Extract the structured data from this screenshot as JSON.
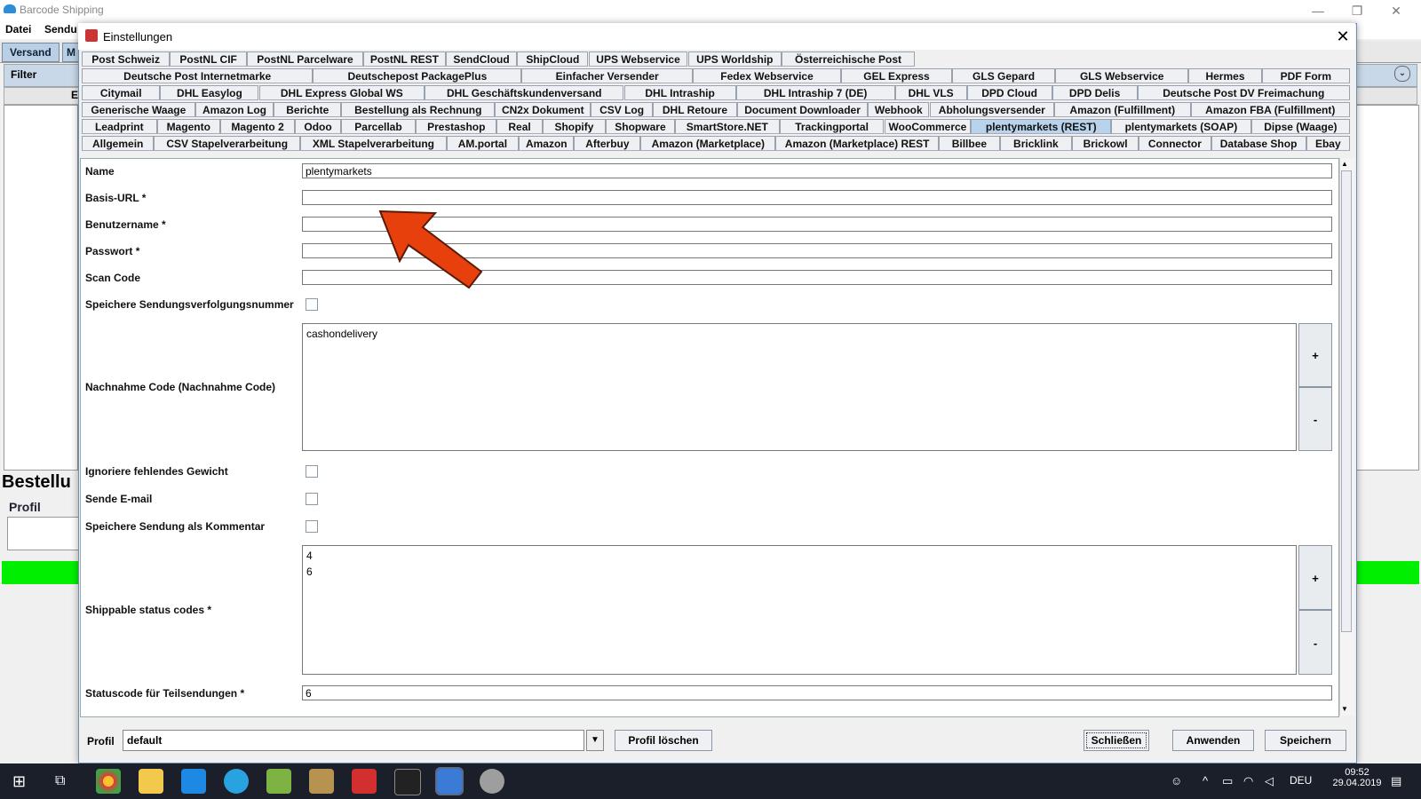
{
  "app": {
    "title": "Barcode Shipping",
    "menu": [
      "Datei",
      "Sendu"
    ],
    "tabs": [
      "Versand",
      "M"
    ],
    "filter_label": "Filter",
    "list_header": "E",
    "section_title": "Bestellu",
    "profil_label": "Profil"
  },
  "dialog": {
    "title": "Einstellungen",
    "close_glyph": "✕",
    "tab_rows": [
      [
        "Post Schweiz",
        "PostNL CIF",
        "PostNL Parcelware",
        "PostNL REST",
        "SendCloud",
        "ShipCloud",
        "UPS Webservice",
        "UPS Worldship",
        "Österreichische Post"
      ],
      [
        "Deutsche Post Internetmarke",
        "Deutschepost PackagePlus",
        "Einfacher Versender",
        "Fedex Webservice",
        "GEL Express",
        "GLS Gepard",
        "GLS Webservice",
        "Hermes",
        "PDF Form"
      ],
      [
        "Citymail",
        "DHL Easylog",
        "DHL Express Global WS",
        "DHL Geschäftskundenversand",
        "DHL Intraship",
        "DHL Intraship 7 (DE)",
        "DHL VLS",
        "DPD Cloud",
        "DPD Delis",
        "Deutsche Post DV Freimachung"
      ],
      [
        "Generische Waage",
        "Amazon Log",
        "Berichte",
        "Bestellung als Rechnung",
        "CN2x Dokument",
        "CSV Log",
        "DHL Retoure",
        "Document Downloader",
        "Webhook",
        "Abholungsversender",
        "Amazon (Fulfillment)",
        "Amazon FBA (Fulfillment)"
      ],
      [
        "Leadprint",
        "Magento",
        "Magento 2",
        "Odoo",
        "Parcellab",
        "Prestashop",
        "Real",
        "Shopify",
        "Shopware",
        "SmartStore.NET",
        "Trackingportal",
        "WooCommerce",
        "plentymarkets (REST)",
        "plentymarkets (SOAP)",
        "Dipse (Waage)"
      ],
      [
        "Allgemein",
        "CSV Stapelverarbeitung",
        "XML Stapelverarbeitung",
        "AM.portal",
        "Amazon",
        "Afterbuy",
        "Amazon (Marketplace)",
        "Amazon (Marketplace) REST",
        "Billbee",
        "Bricklink",
        "Brickowl",
        "Connector",
        "Database Shop",
        "Ebay"
      ]
    ],
    "active_tab": "plentymarkets (REST)",
    "form": {
      "name_label": "Name",
      "name_value": "plentymarkets",
      "baseurl_label": "Basis-URL *",
      "baseurl_value": "",
      "user_label": "Benutzername *",
      "user_value": "",
      "pass_label": "Passwort *",
      "pass_value": "",
      "scan_label": "Scan Code",
      "scan_value": "",
      "save_tracking_label": "Speichere Sendungsverfolgungsnummer",
      "cod_label": "Nachnahme Code (Nachnahme Code)",
      "cod_values": [
        "cashondelivery"
      ],
      "ignore_weight_label": "Ignoriere fehlendes Gewicht",
      "send_email_label": "Sende E-mail",
      "save_comment_label": "Speichere Sendung als Kommentar",
      "shippable_label": "Shippable status codes *",
      "shippable_values": [
        "4",
        "6"
      ],
      "partial_label": "Statuscode für Teilsendungen *",
      "partial_value": "6",
      "plus": "+",
      "minus": "-"
    },
    "bottom": {
      "profil_label": "Profil",
      "profil_value": "default",
      "delete_profile": "Profil löschen",
      "close": "Schließen",
      "apply": "Anwenden",
      "save": "Speichern"
    }
  },
  "taskbar": {
    "lang": "DEU",
    "time": "09:52",
    "date": "29.04.2019"
  },
  "colors": {
    "active_tab": "#b9d3ec",
    "arrow": "#e8400c",
    "green_bar": "#00ee00"
  }
}
